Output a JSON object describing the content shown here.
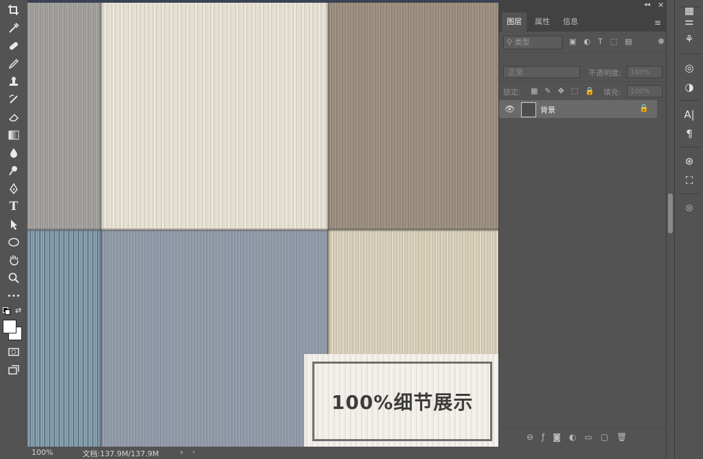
{
  "toolbar": {
    "tools": [
      {
        "name": "crop-tool-icon"
      },
      {
        "name": "eyedropper-tool-icon"
      },
      {
        "name": "healing-brush-tool-icon"
      },
      {
        "name": "brush-tool-icon"
      },
      {
        "name": "clone-stamp-tool-icon"
      },
      {
        "name": "history-brush-tool-icon"
      },
      {
        "name": "eraser-tool-icon"
      },
      {
        "name": "gradient-tool-icon"
      },
      {
        "name": "blur-tool-icon"
      },
      {
        "name": "dodge-tool-icon"
      },
      {
        "name": "pen-tool-icon"
      },
      {
        "name": "type-tool-icon",
        "glyph": "T"
      },
      {
        "name": "path-selection-tool-icon"
      },
      {
        "name": "ellipse-tool-icon"
      },
      {
        "name": "hand-tool-icon"
      },
      {
        "name": "zoom-tool-icon"
      },
      {
        "name": "more-tools-icon",
        "glyph": "•••"
      }
    ],
    "foreground_color": "#ffffff",
    "background_color": "#ffffff"
  },
  "canvas": {
    "overlay_text": "100%细节展示"
  },
  "status_bar": {
    "zoom": "100%",
    "doc_info": "文档:137.9M/137.9M",
    "arrow": "›"
  },
  "layers_panel": {
    "tabs": [
      {
        "label": "图层",
        "active": true
      },
      {
        "label": "属性",
        "active": false
      },
      {
        "label": "信息",
        "active": false
      }
    ],
    "filter_placeholder": "类型",
    "blend_mode": "正常",
    "opacity_label": "不透明度:",
    "opacity_value": "100%",
    "lock_label": "锁定:",
    "fill_label": "填充:",
    "fill_value": "100%",
    "layers": [
      {
        "name": "背景",
        "visible": true,
        "locked": true
      }
    ]
  },
  "right_strip": {
    "icons": [
      "adjustments-icon",
      "brush-settings-icon",
      "libraries-icon",
      "adjustment-layer-icon",
      "character-icon",
      "paragraph-icon",
      "channels-icon",
      "paths-icon",
      "properties-icon"
    ]
  },
  "colors": {
    "ui_dark": "#535353",
    "panel_header": "#424242",
    "selected_layer": "#6a6a6a"
  }
}
